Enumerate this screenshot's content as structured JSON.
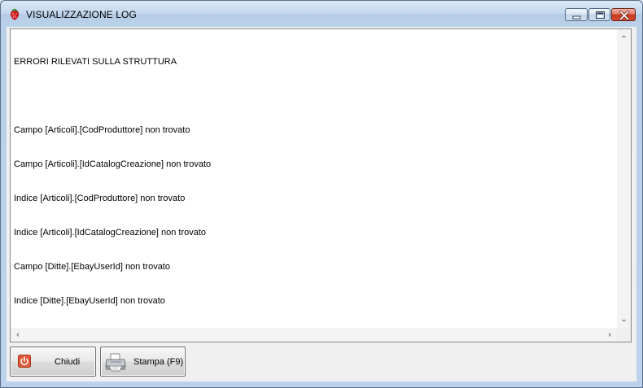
{
  "window": {
    "title": "VISUALIZZAZIONE LOG",
    "icon": "strawberry-icon",
    "controls": [
      "minimize-icon",
      "maximize-icon",
      "close-icon"
    ]
  },
  "log": {
    "lines": [
      "ERRORI RILEVATI SULLA STRUTTURA",
      "",
      "Campo [Articoli].[CodProduttore] non trovato",
      "Campo [Articoli].[IdCatalogCreazione] non trovato",
      "Indice [Articoli].[CodProduttore] non trovato",
      "Indice [Articoli].[IdCatalogCreazione] non trovato",
      "Campo [Ditte].[EbayUserId] non trovato",
      "Indice [Ditte].[EbayUserId] non trovato"
    ]
  },
  "buttons": {
    "close_label": "Chiudi",
    "close_icon": "power-icon",
    "print_label": "Stampa (F9)",
    "print_icon": "printer-icon"
  },
  "colors": {
    "titlebar": "#bcd2ea",
    "close_button": "#c5381c",
    "power_icon": "#e05a3a"
  }
}
